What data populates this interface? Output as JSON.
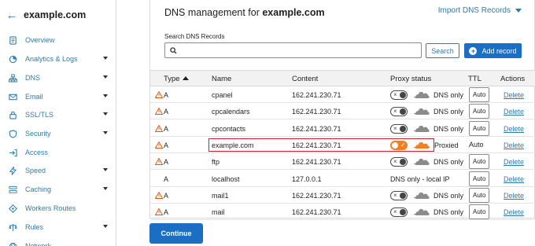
{
  "sidebar": {
    "domain": "example.com",
    "items": [
      {
        "label": "Overview",
        "icon": "overview-icon",
        "caret": false
      },
      {
        "label": "Analytics & Logs",
        "icon": "analytics-icon",
        "caret": true
      },
      {
        "label": "DNS",
        "icon": "dns-icon",
        "caret": true
      },
      {
        "label": "Email",
        "icon": "email-icon",
        "caret": true
      },
      {
        "label": "SSL/TLS",
        "icon": "lock-icon",
        "caret": true
      },
      {
        "label": "Security",
        "icon": "shield-icon",
        "caret": true
      },
      {
        "label": "Access",
        "icon": "access-icon",
        "caret": false
      },
      {
        "label": "Speed",
        "icon": "bolt-icon",
        "caret": true
      },
      {
        "label": "Caching",
        "icon": "caching-icon",
        "caret": true
      },
      {
        "label": "Workers Routes",
        "icon": "workers-icon",
        "caret": false
      },
      {
        "label": "Rules",
        "icon": "rules-icon",
        "caret": true
      },
      {
        "label": "Network",
        "icon": "network-icon",
        "caret": false
      }
    ]
  },
  "main": {
    "title_prefix": "DNS management for ",
    "title_domain": "example.com",
    "import_label": "Import DNS Records",
    "search_label": "Search DNS Records",
    "search_value": "",
    "search_button": "Search",
    "add_button": "Add record",
    "continue_button": "Continue"
  },
  "table": {
    "headers": {
      "type": "Type",
      "name": "Name",
      "content": "Content",
      "proxy": "Proxy status",
      "ttl": "TTL",
      "actions": "Actions"
    },
    "rows": [
      {
        "warn": true,
        "type": "A",
        "name": "cpanel",
        "content": "162.241.230.71",
        "proxied": false,
        "proxy_label": "DNS only",
        "ttl": "Auto",
        "ttl_select": true,
        "action": "Delete"
      },
      {
        "warn": true,
        "type": "A",
        "name": "cpcalendars",
        "content": "162.241.230.71",
        "proxied": false,
        "proxy_label": "DNS only",
        "ttl": "Auto",
        "ttl_select": true,
        "action": "Delete"
      },
      {
        "warn": true,
        "type": "A",
        "name": "cpcontacts",
        "content": "162.241.230.71",
        "proxied": false,
        "proxy_label": "DNS only",
        "ttl": "Auto",
        "ttl_select": true,
        "action": "Delete"
      },
      {
        "warn": true,
        "type": "A",
        "name": "example.com",
        "content": "162.241.230.71",
        "proxied": true,
        "proxy_label": "Proxied",
        "ttl": "Auto",
        "ttl_select": false,
        "action": "Delete"
      },
      {
        "warn": true,
        "type": "A",
        "name": "ftp",
        "content": "162.241.230.71",
        "proxied": false,
        "proxy_label": "DNS only",
        "ttl": "Auto",
        "ttl_select": true,
        "action": "Delete"
      },
      {
        "warn": false,
        "type": "A",
        "name": "localhost",
        "content": "127.0.0.1",
        "proxied": null,
        "proxy_label": "DNS only - local IP",
        "ttl": "Auto",
        "ttl_select": true,
        "action": "Delete"
      },
      {
        "warn": true,
        "type": "A",
        "name": "mail1",
        "content": "162.241.230.71",
        "proxied": false,
        "proxy_label": "DNS only",
        "ttl": "Auto",
        "ttl_select": true,
        "action": "Delete"
      },
      {
        "warn": true,
        "type": "A",
        "name": "mail",
        "content": "162.241.230.71",
        "proxied": false,
        "proxy_label": "DNS only",
        "ttl": "Auto",
        "ttl_select": true,
        "action": "Delete"
      }
    ]
  },
  "colors": {
    "accent": "#2c7cb0",
    "primary_button": "#1a6fc4",
    "proxied_orange": "#f38020",
    "warning": "#e05a1a",
    "highlight": "#c8202f"
  }
}
